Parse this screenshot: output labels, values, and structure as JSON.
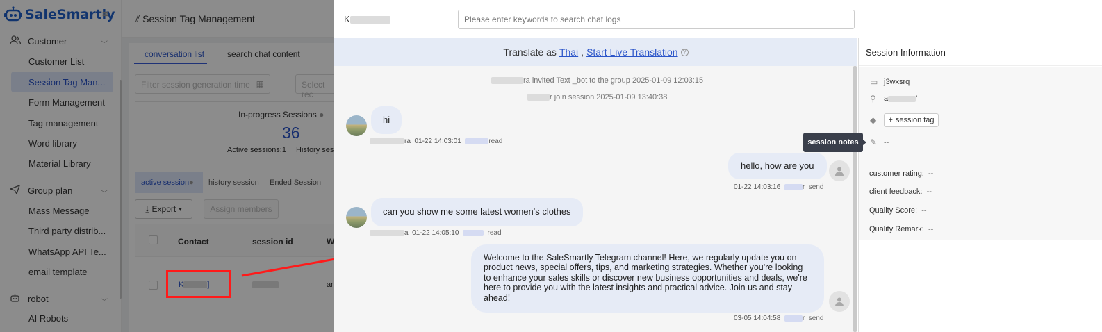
{
  "brand": {
    "name": "SaleSmartly"
  },
  "sidebar": {
    "groups": [
      {
        "label": "Customer",
        "icon": "users-icon"
      },
      {
        "label": "Group plan",
        "icon": "send-icon"
      },
      {
        "label": "robot",
        "icon": "robot-icon"
      }
    ],
    "customer_items": [
      "Customer List",
      "Session Tag Man...",
      "Form Management",
      "Tag management",
      "Word library",
      "Material Library"
    ],
    "group_items": [
      "Mass Message",
      "Third party distrib...",
      "WhatsApp API Te...",
      "email template"
    ],
    "robot_items": [
      "AI Robots"
    ]
  },
  "main": {
    "title": "Session Tag Management",
    "tabs": [
      "conversation list",
      "search chat content"
    ],
    "filter_time_placeholder": "Filter session generation time",
    "filter_select_placeholder": "Select rec",
    "stats": {
      "label": "In-progress Sessions",
      "value": "36",
      "active": "Active sessions:1",
      "history": "History sess"
    },
    "subtabs": [
      "active session",
      "history session",
      "Ended Session"
    ],
    "export_label": "Export",
    "assign_label": "Assign members",
    "table_headers": [
      "Contact",
      "session id",
      "W"
    ],
    "row": {
      "contact": "K",
      "contact_end": "]",
      "wcol": "an"
    }
  },
  "drawer": {
    "contact_name": "K",
    "search_placeholder": "Please enter keywords to search chat logs",
    "translate": {
      "prefix": "Translate as",
      "language": "Thai",
      "separator": ",",
      "action": "Start Live Translation"
    },
    "system_messages": [
      "ra invited Text _bot to the group 2025-01-09 12:03:15",
      "r join session 2025-01-09 13:40:38"
    ],
    "messages": [
      {
        "text": "hi",
        "sender_suffix": "ra",
        "time": "01-22 14:03:01",
        "status": "read",
        "direction": "in"
      },
      {
        "text": "hello, how are you",
        "time": "01-22 14:03:16",
        "agent_suffix": "r",
        "status": "send",
        "direction": "out"
      },
      {
        "text": "can you show me some latest women's clothes",
        "sender_suffix": "a",
        "time": "01-22 14:05:10",
        "status": "read",
        "direction": "in"
      },
      {
        "text": "Welcome to the SaleSmartly Telegram channel! Here, we regularly update you on product news, special offers, tips, and marketing strategies. Whether you're looking to enhance your sales skills or discover new business opportunities and deals, we're here to provide you with the latest insights and practical advice. Join us and stay ahead!",
        "time": "03-05 14:04:58",
        "agent_suffix": "r",
        "status": "send",
        "direction": "out"
      }
    ],
    "info": {
      "title": "Session Information",
      "id": "j3wxsrq",
      "agent_prefix": "a",
      "agent_suffix": "'",
      "tag_button": "session tag",
      "notes_value": "--",
      "tooltip": "session notes",
      "fields": [
        {
          "label": "customer rating:",
          "value": "--"
        },
        {
          "label": "client feedback:",
          "value": "--"
        },
        {
          "label": "Quality Score:",
          "value": "--"
        },
        {
          "label": "Quality Remark:",
          "value": "--"
        }
      ]
    }
  },
  "colors": {
    "brand": "#1f5fc9",
    "accent": "#2b55c9",
    "highlight": "#ff1a1a",
    "bubble": "#e6ebf6"
  }
}
